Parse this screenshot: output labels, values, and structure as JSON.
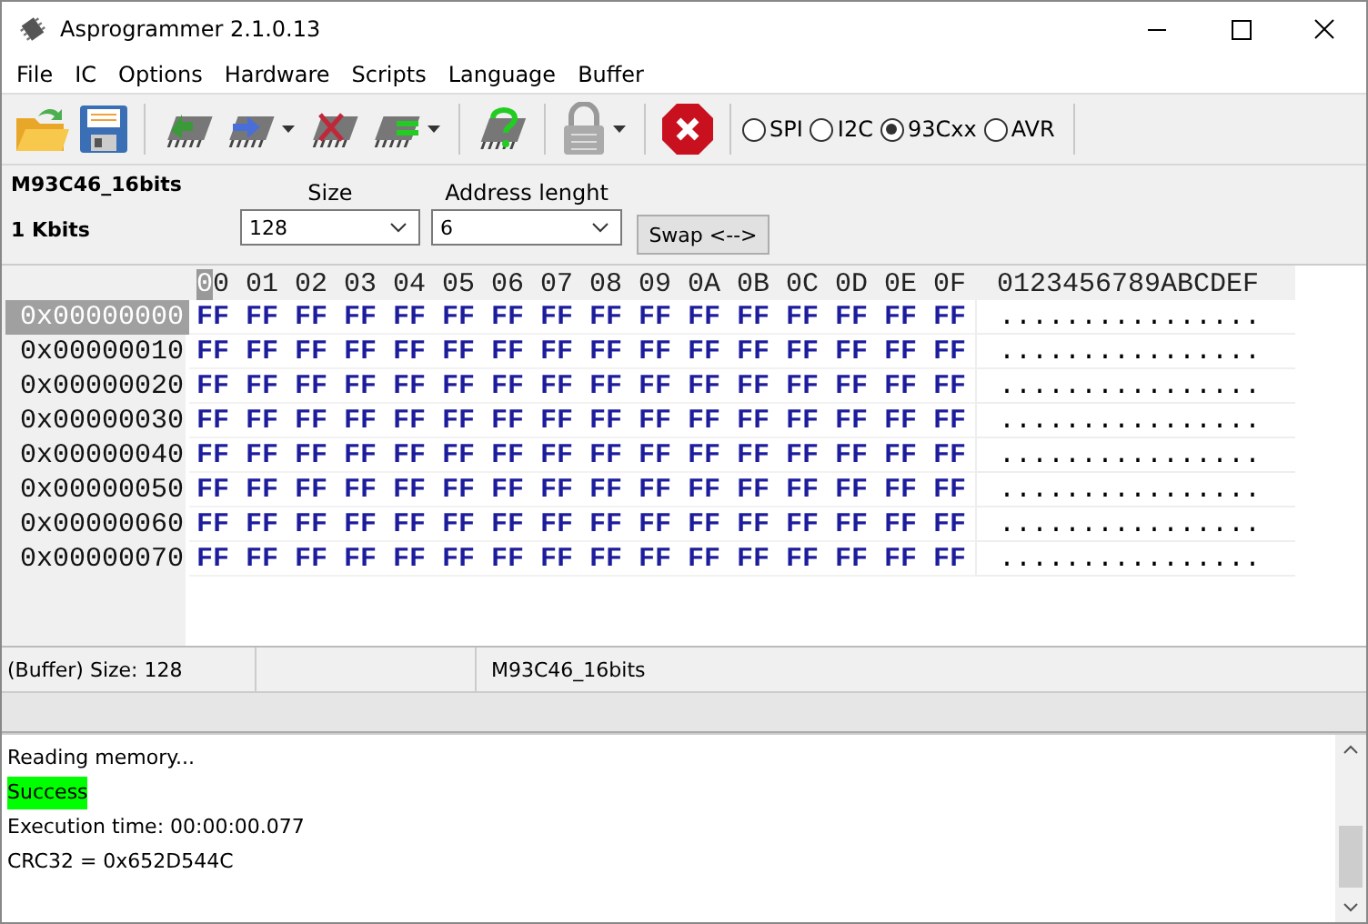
{
  "window": {
    "title": "Asprogrammer 2.1.0.13"
  },
  "menu": [
    "File",
    "IC",
    "Options",
    "Hardware",
    "Scripts",
    "Language",
    "Buffer"
  ],
  "toolbar": {
    "protocols": [
      {
        "label": "SPI",
        "selected": false
      },
      {
        "label": "I2C",
        "selected": false
      },
      {
        "label": "93Cxx",
        "selected": true
      },
      {
        "label": "AVR",
        "selected": false
      }
    ]
  },
  "chip": {
    "name": "M93C46_16bits",
    "capacity": "1 Kbits",
    "size": {
      "label": "Size",
      "value": "128"
    },
    "address_length": {
      "label": "Address lenght",
      "value": "6"
    },
    "swap_button": "Swap <-->"
  },
  "hex": {
    "columns": [
      "00",
      "01",
      "02",
      "03",
      "04",
      "05",
      "06",
      "07",
      "08",
      "09",
      "0A",
      "0B",
      "0C",
      "0D",
      "0E",
      "0F"
    ],
    "ascii_header": "0123456789ABCDEF",
    "rows": [
      {
        "address": "0x00000000",
        "selected": true,
        "bytes": [
          "FF",
          "FF",
          "FF",
          "FF",
          "FF",
          "FF",
          "FF",
          "FF",
          "FF",
          "FF",
          "FF",
          "FF",
          "FF",
          "FF",
          "FF",
          "FF"
        ],
        "ascii": "................"
      },
      {
        "address": "0x00000010",
        "selected": false,
        "bytes": [
          "FF",
          "FF",
          "FF",
          "FF",
          "FF",
          "FF",
          "FF",
          "FF",
          "FF",
          "FF",
          "FF",
          "FF",
          "FF",
          "FF",
          "FF",
          "FF"
        ],
        "ascii": "................"
      },
      {
        "address": "0x00000020",
        "selected": false,
        "bytes": [
          "FF",
          "FF",
          "FF",
          "FF",
          "FF",
          "FF",
          "FF",
          "FF",
          "FF",
          "FF",
          "FF",
          "FF",
          "FF",
          "FF",
          "FF",
          "FF"
        ],
        "ascii": "................"
      },
      {
        "address": "0x00000030",
        "selected": false,
        "bytes": [
          "FF",
          "FF",
          "FF",
          "FF",
          "FF",
          "FF",
          "FF",
          "FF",
          "FF",
          "FF",
          "FF",
          "FF",
          "FF",
          "FF",
          "FF",
          "FF"
        ],
        "ascii": "................"
      },
      {
        "address": "0x00000040",
        "selected": false,
        "bytes": [
          "FF",
          "FF",
          "FF",
          "FF",
          "FF",
          "FF",
          "FF",
          "FF",
          "FF",
          "FF",
          "FF",
          "FF",
          "FF",
          "FF",
          "FF",
          "FF"
        ],
        "ascii": "................"
      },
      {
        "address": "0x00000050",
        "selected": false,
        "bytes": [
          "FF",
          "FF",
          "FF",
          "FF",
          "FF",
          "FF",
          "FF",
          "FF",
          "FF",
          "FF",
          "FF",
          "FF",
          "FF",
          "FF",
          "FF",
          "FF"
        ],
        "ascii": "................"
      },
      {
        "address": "0x00000060",
        "selected": false,
        "bytes": [
          "FF",
          "FF",
          "FF",
          "FF",
          "FF",
          "FF",
          "FF",
          "FF",
          "FF",
          "FF",
          "FF",
          "FF",
          "FF",
          "FF",
          "FF",
          "FF"
        ],
        "ascii": "................"
      },
      {
        "address": "0x00000070",
        "selected": false,
        "bytes": [
          "FF",
          "FF",
          "FF",
          "FF",
          "FF",
          "FF",
          "FF",
          "FF",
          "FF",
          "FF",
          "FF",
          "FF",
          "FF",
          "FF",
          "FF",
          "FF"
        ],
        "ascii": "................"
      }
    ]
  },
  "progress": {
    "level": 0
  },
  "status_bar": {
    "buffer_size": "(Buffer) Size: 128",
    "chip": "M93C46_16bits"
  },
  "log": [
    {
      "text": "Reading memory...",
      "kind": "plain"
    },
    {
      "text": "Success",
      "kind": "success"
    },
    {
      "text": "Execution time: 00:00:00.077",
      "kind": "plain"
    },
    {
      "text": "CRC32 = 0x652D544C",
      "kind": "plain"
    }
  ]
}
